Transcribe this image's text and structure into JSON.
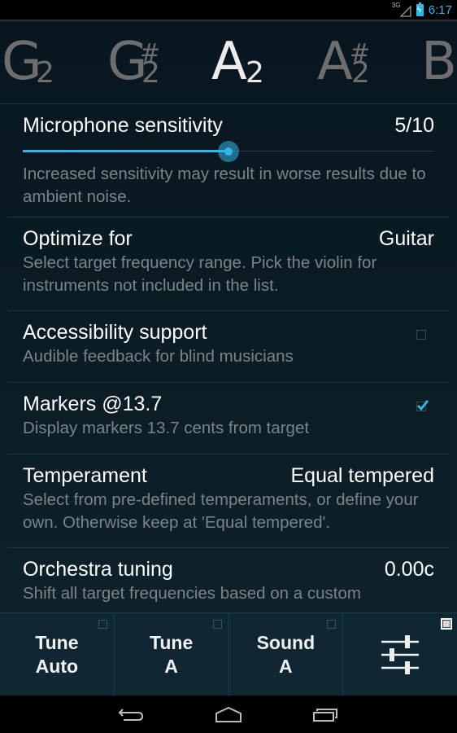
{
  "status_bar": {
    "network": "3G",
    "time": "6:17",
    "accent_color": "#33b5e5"
  },
  "note_strip": {
    "notes": [
      {
        "letter": "G",
        "sharp": "",
        "octave": "2",
        "active": false
      },
      {
        "letter": "G",
        "sharp": "#",
        "octave": "2",
        "active": false
      },
      {
        "letter": "A",
        "sharp": "",
        "octave": "2",
        "active": true
      },
      {
        "letter": "A",
        "sharp": "#",
        "octave": "2",
        "active": false
      },
      {
        "letter": "B",
        "sharp": "",
        "octave": "",
        "active": false
      }
    ]
  },
  "settings": {
    "microphone": {
      "title": "Microphone sensitivity",
      "value": "5/10",
      "slider_fraction": 0.5,
      "summary": "Increased sensitivity may result in worse results due to ambient noise."
    },
    "optimize": {
      "title": "Optimize for",
      "value": "Guitar",
      "summary": "Select target frequency range. Pick the violin for instruments not included in the list."
    },
    "accessibility": {
      "title": "Accessibility support",
      "summary": "Audible feedback for blind musicians",
      "checked": false
    },
    "markers": {
      "title": "Markers @13.7",
      "summary": "Display markers 13.7 cents from target",
      "checked": true
    },
    "temperament": {
      "title": "Temperament",
      "value": "Equal tempered",
      "summary": "Select from pre-defined temperaments, or define your own. Otherwise keep at 'Equal tempered'."
    },
    "orchestra": {
      "title": "Orchestra tuning",
      "value": "0.00c",
      "summary": "Shift all target frequencies based on a custom"
    }
  },
  "bottom_bar": {
    "buttons": [
      {
        "line1": "Tune",
        "line2": "Auto"
      },
      {
        "line1": "Tune",
        "line2": "A"
      },
      {
        "line1": "Sound",
        "line2": "A"
      }
    ],
    "settings_icon": "sliders-icon"
  },
  "nav_bar": {
    "back": "back-icon",
    "home": "home-icon",
    "recents": "recents-icon"
  }
}
